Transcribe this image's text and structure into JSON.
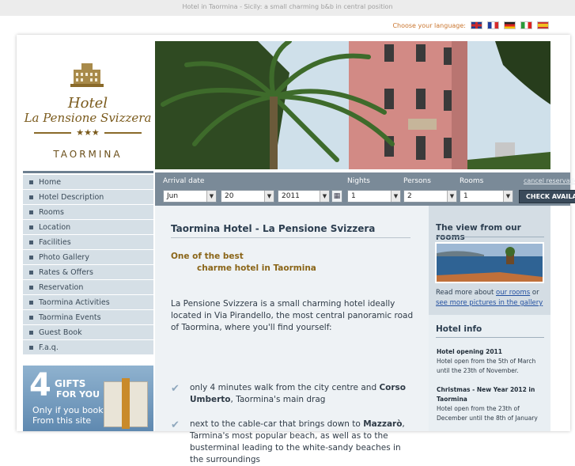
{
  "top_tagline": "Hotel in Taormina - Sicily: a small charming b&b in central position",
  "language": {
    "label": "Choose your language:",
    "flags": [
      "english-flag",
      "french-flag",
      "german-flag",
      "italian-flag",
      "spanish-flag"
    ]
  },
  "logo": {
    "line1": "Hotel",
    "line2": "La Pensione Svizzera",
    "stars": "★★★",
    "city": "TAORMINA"
  },
  "nav": {
    "items": [
      {
        "label": "Home"
      },
      {
        "label": "Hotel Description"
      },
      {
        "label": "Rooms"
      },
      {
        "label": "Location"
      },
      {
        "label": "Facilities"
      },
      {
        "label": "Photo Gallery"
      },
      {
        "label": "Rates & Offers"
      },
      {
        "label": "Reservation"
      },
      {
        "label": "Taormina Activities"
      },
      {
        "label": "Taormina Events"
      },
      {
        "label": "Guest Book"
      },
      {
        "label": "F.a.q."
      }
    ]
  },
  "gifts": {
    "number": "4",
    "word1": "GIFTS",
    "word2": "FOR YOU",
    "line1": "Only if you book",
    "line2": "From this site"
  },
  "booking": {
    "arrival_label": "Arrival date",
    "nights_label": "Nights",
    "persons_label": "Persons",
    "rooms_label": "Rooms",
    "cancel_link": "cancel reservation",
    "month": "Jun",
    "day": "20",
    "year": "2011",
    "nights": "1",
    "persons": "2",
    "rooms": "1",
    "check_button": "CHECK AVAILABILITY"
  },
  "main": {
    "title": "Taormina Hotel - La Pensione Svizzera",
    "subtitle1": "One of the best",
    "subtitle2": "charme hotel in Taormina",
    "intro": "La Pensione Svizzera is a small charming hotel ideally located in Via Pirandello, the most central panoramic road of Taormina, where you'll find yourself:",
    "bullet1_a": "only 4 minutes walk from the city centre and ",
    "bullet1_b": "Corso Umberto",
    "bullet1_c": ", Taormina's main drag",
    "bullet2_a": "next to the cable-car that brings down to ",
    "bullet2_b": "Mazzarò",
    "bullet2_c": ", Tarmina's most popular beach, as well as to the busterminal leading to the white-sandy beaches in the surroundings"
  },
  "right": {
    "view_heading": "The view from our rooms",
    "more_prefix": "Read more about ",
    "more_link1": "our rooms",
    "more_mid": " or",
    "more_link2": "see more pictures in the gallery",
    "info_heading": "Hotel info",
    "news1_title": "Hotel opening 2011",
    "news1_text": "Hotel open from the 5th of March until the 23th of November.",
    "news2_title": "Christmas - New Year 2012 in Taormina",
    "news2_text": "Hotel open from the 23th of December until the 8th of January"
  }
}
